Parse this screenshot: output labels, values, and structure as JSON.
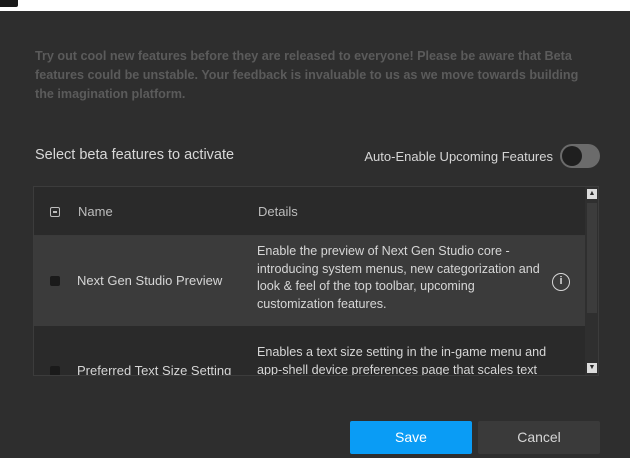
{
  "description": "Try out cool new features before they are released to everyone! Please be aware that Beta features could be unstable. Your feedback is invaluable to us as we move towards building the imagination platform.",
  "select_title": "Select beta features to activate",
  "auto_enable": {
    "label": "Auto-Enable Upcoming Features",
    "enabled": false
  },
  "table": {
    "headers": {
      "name": "Name",
      "details": "Details"
    },
    "rows": [
      {
        "name": "Next Gen Studio Preview",
        "details": "Enable the preview of Next Gen Studio core - introducing system menus, new categorization and look & feel of the top toolbar, upcoming customization features.",
        "checked": false,
        "has_info": true,
        "info_icon": "info-icon"
      },
      {
        "name": "Preferred Text Size Setting",
        "details": "Enables a text size setting in the in-game menu and app-shell device preferences page that scales text",
        "checked": false,
        "has_info": false
      }
    ]
  },
  "buttons": {
    "save": "Save",
    "cancel": "Cancel"
  },
  "colors": {
    "accent": "#0a9cf5",
    "background": "#2e2e2e",
    "row_highlight": "#3b3b3b"
  }
}
